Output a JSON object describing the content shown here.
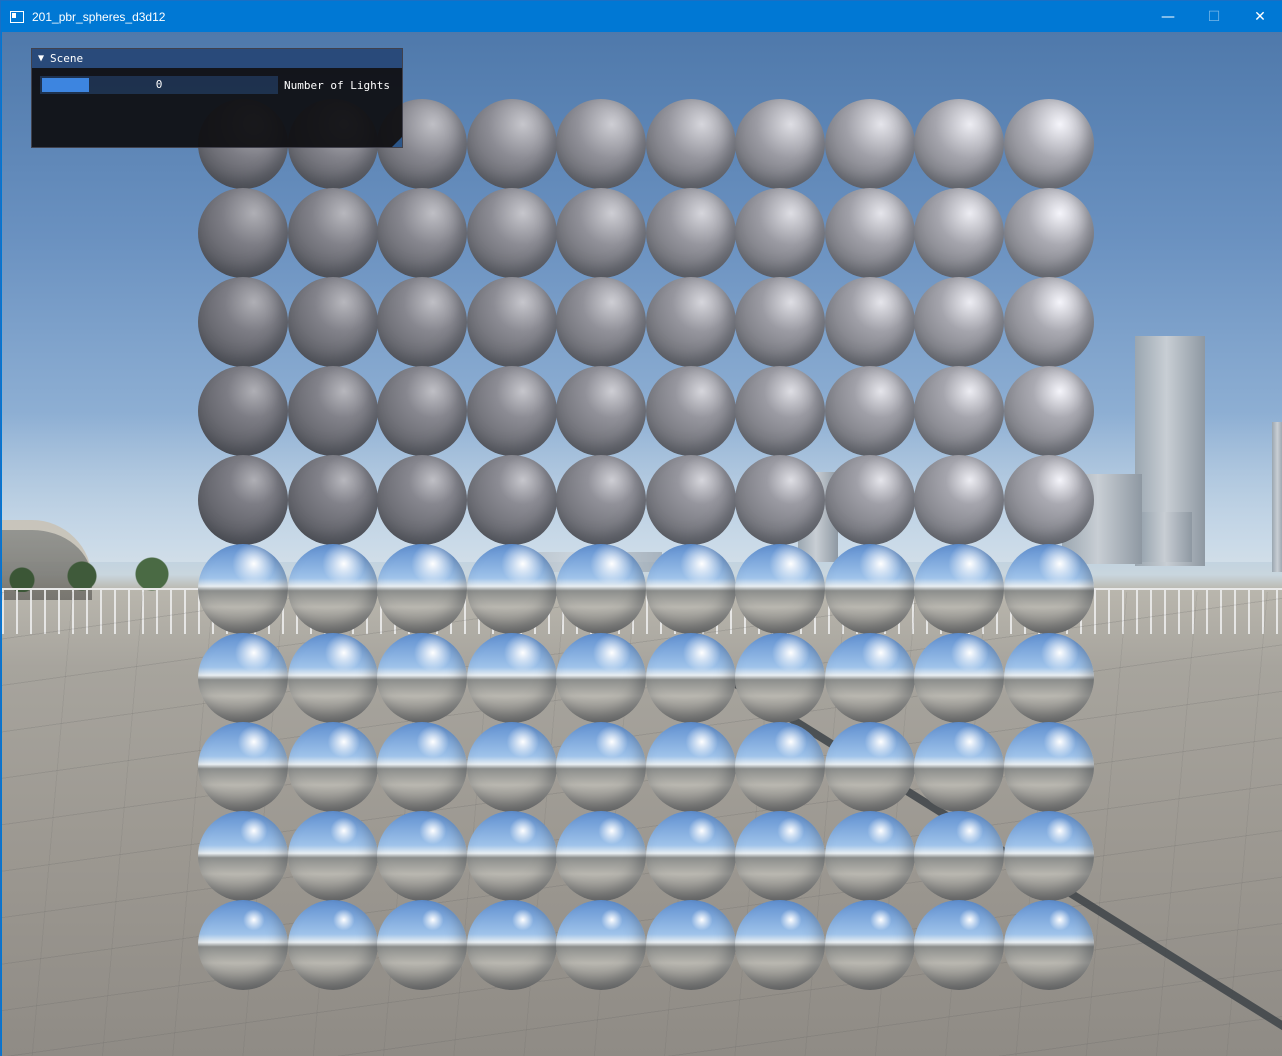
{
  "window": {
    "title": "201_pbr_spheres_d3d12",
    "icon": "app-window-icon",
    "controls": {
      "minimize": "—",
      "maximize": "☐",
      "close": "✕"
    }
  },
  "scene_panel": {
    "title": "Scene",
    "collapse_icon": "▼",
    "slider": {
      "label": "Number of Lights",
      "value": "0",
      "fill_fraction": 0.2
    }
  },
  "sphere_grid": {
    "rows": 10,
    "columns": 10
  },
  "colors": {
    "titlebar": "#0078d4",
    "panel_title": "#294a7a",
    "slider_grab": "#3d85e0",
    "panel_bg": "#0f0f12"
  }
}
